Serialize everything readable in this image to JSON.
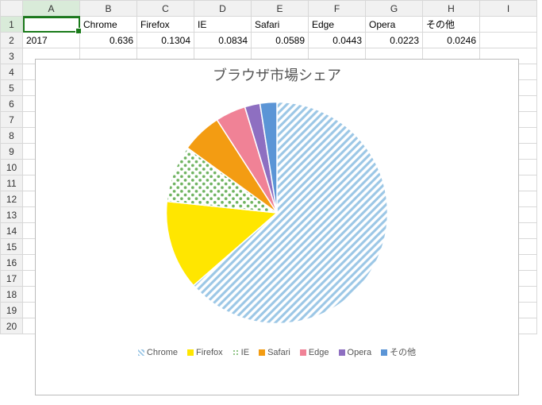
{
  "columns": [
    "",
    "A",
    "B",
    "C",
    "D",
    "E",
    "F",
    "G",
    "H",
    "I"
  ],
  "rows": 20,
  "selected_cell": {
    "row": 1,
    "col": 1
  },
  "table": {
    "header_row": 1,
    "data_row": 2,
    "headers": [
      "",
      "Chrome",
      "Firefox",
      "IE",
      "Safari",
      "Edge",
      "Opera",
      "その他"
    ],
    "row_label": "2017",
    "values": [
      0.636,
      0.1304,
      0.0834,
      0.0589,
      0.0443,
      0.0223,
      0.0246
    ]
  },
  "chart_data": {
    "type": "pie",
    "title": "ブラウザ市場シェア",
    "categories": [
      "Chrome",
      "Firefox",
      "IE",
      "Safari",
      "Edge",
      "Opera",
      "その他"
    ],
    "values": [
      0.636,
      0.1304,
      0.0834,
      0.0589,
      0.0443,
      0.0223,
      0.0246
    ],
    "colors": [
      "#9cc7e6",
      "#ffe600",
      "#6eb360",
      "#f39c12",
      "#f08296",
      "#8e6fc1",
      "#5b95d6"
    ],
    "patterns": [
      "diag",
      "solid",
      "dots",
      "solid",
      "solid",
      "solid",
      "solid"
    ],
    "legend_position": "bottom"
  }
}
